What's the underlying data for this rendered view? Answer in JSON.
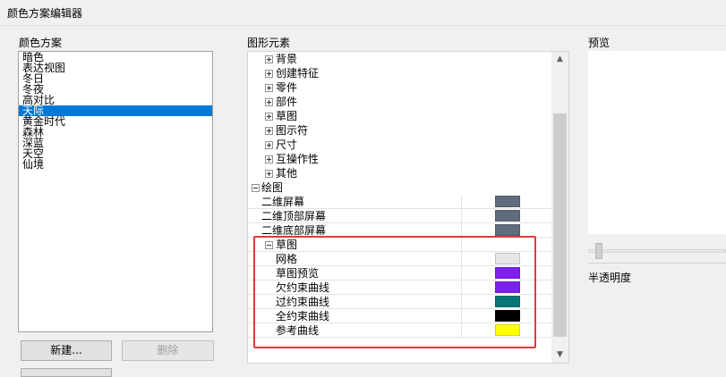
{
  "window": {
    "title": "颜色方案编辑器"
  },
  "schemes": {
    "label": "颜色方案",
    "items": [
      "暗色",
      "表达视图",
      "冬日",
      "冬夜",
      "高对比",
      "天际",
      "黄金时代",
      "森林",
      "深蓝",
      "天空",
      "仙境"
    ],
    "selected_index": 5
  },
  "buttons": {
    "new": "新建...",
    "delete": "删除"
  },
  "elements": {
    "label": "图形元素",
    "collapsed_groups": [
      "背景",
      "创建特征",
      "零件",
      "部件",
      "草图",
      "图示符",
      "尺寸",
      "互操作性",
      "其他"
    ],
    "drawing": {
      "label": "绘图",
      "rows": [
        {
          "label": "二维屏幕",
          "color": "#5f6c7d"
        },
        {
          "label": "二维顶部屏幕",
          "color": "#5f6c7d"
        },
        {
          "label": "二维底部屏幕",
          "color": "#5f6c7d"
        }
      ],
      "sketch": {
        "label": "草图",
        "rows": [
          {
            "label": "网格",
            "color": "#e6e6e6"
          },
          {
            "label": "草图预览",
            "color": "#7f1ef0"
          },
          {
            "label": "欠约束曲线",
            "color": "#7b22ea"
          },
          {
            "label": "过约束曲线",
            "color": "#087575"
          },
          {
            "label": "全约束曲线",
            "color": "#000000"
          },
          {
            "label": "参考曲线",
            "color": "#ffff00"
          }
        ]
      }
    }
  },
  "preview": {
    "label": "预览"
  },
  "transparency": {
    "label": "半透明度",
    "value": 0.05
  },
  "colors": {
    "selection": "#0078d7",
    "highlight_border": "#e0393e"
  }
}
